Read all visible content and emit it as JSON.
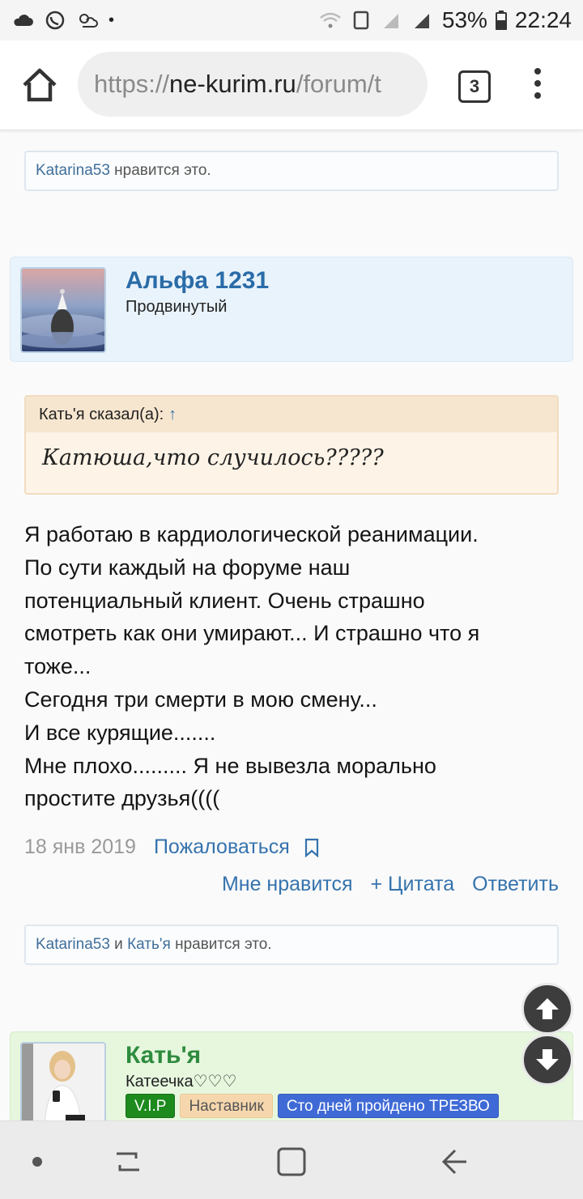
{
  "status_bar": {
    "battery": "53%",
    "time": "22:24"
  },
  "browser": {
    "url_scheme": "https://",
    "url_domain": "ne-kurim.ru",
    "url_path": "/forum/t",
    "tab_count": "3"
  },
  "likes_top": {
    "user1": "Katarina53",
    "suffix": " нравится это."
  },
  "post": {
    "author": "Альфа 1231",
    "rank": "Продвинутый",
    "quote_header": "Кать'я сказал(а):",
    "quote_arrow": "↑",
    "quote_text": "Катюша,что случилось?????",
    "lines": [
      "Я работаю в кардиологической реанимации.",
      "По сути каждый на форуме наш",
      "потенциальный клиент. Очень страшно",
      "смотреть как они умирают... И страшно что я",
      "тоже...",
      "Сегодня три смерти в мою смену...",
      "И все курящие.......",
      "Мне плохо......... Я не вывезла морально",
      "простите друзья(((("
    ],
    "date": "18 янв 2019",
    "report_label": "Пожаловаться",
    "actions": {
      "like": "Мне нравится",
      "quote": "+ Цитата",
      "reply": "Ответить"
    }
  },
  "likes_bottom": {
    "user1": "Katarina53",
    "and": " и ",
    "user2": "Кать'я",
    "suffix": " нравится это."
  },
  "next_post": {
    "author": "Кать'я",
    "rank": "Катеечка♡♡♡",
    "badges": [
      "V.I.P",
      "Наставник",
      "Сто дней пройдено ТРЕЗВО"
    ]
  },
  "colors": {
    "link": "#3573ad",
    "author_blue": "#2a6ca8",
    "author_green": "#2e8b3e",
    "quote_bg": "#fdf4e7",
    "post_head_bg": "#e9f3fb",
    "next_head_bg": "#e6f7de"
  }
}
